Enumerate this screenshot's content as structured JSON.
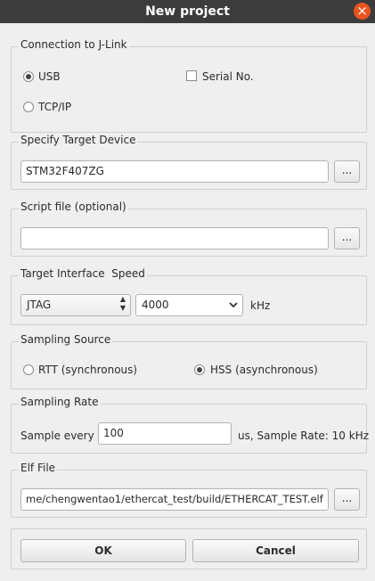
{
  "window": {
    "title": "New project",
    "close_glyph": "×"
  },
  "connection": {
    "title": "Connection to J-Link",
    "usb_label": "USB",
    "usb_checked": true,
    "tcpip_label": "TCP/IP",
    "tcpip_checked": false,
    "serial_label": "Serial No.",
    "serial_checked": false
  },
  "target_device": {
    "title": "Specify Target Device",
    "value": "STM32F407ZG",
    "browse_label": "..."
  },
  "script_file": {
    "title": "Script file (optional)",
    "value": "",
    "browse_label": "..."
  },
  "interface": {
    "title": "Target Interface  Speed",
    "interface_value": "JTAG",
    "speed_value": "4000",
    "speed_unit": "kHz"
  },
  "sampling_source": {
    "title": "Sampling Source",
    "rtt_label": "RTT (synchronous)",
    "rtt_checked": false,
    "hss_label": "HSS (asynchronous)",
    "hss_checked": true
  },
  "sampling_rate": {
    "title": "Sampling Rate",
    "prefix": "Sample every",
    "value": "100",
    "suffix": "us, Sample Rate: 10 kHz"
  },
  "elf_file": {
    "title": "Elf File",
    "value": "me/chengwentao1/ethercat_test/build/ETHERCAT_TEST.elf",
    "browse_label": "..."
  },
  "buttons": {
    "ok_label": "OK",
    "cancel_label": "Cancel"
  },
  "colors": {
    "titlebar": "#3c3c3c",
    "close_button": "#e95420",
    "background": "#efefef"
  }
}
